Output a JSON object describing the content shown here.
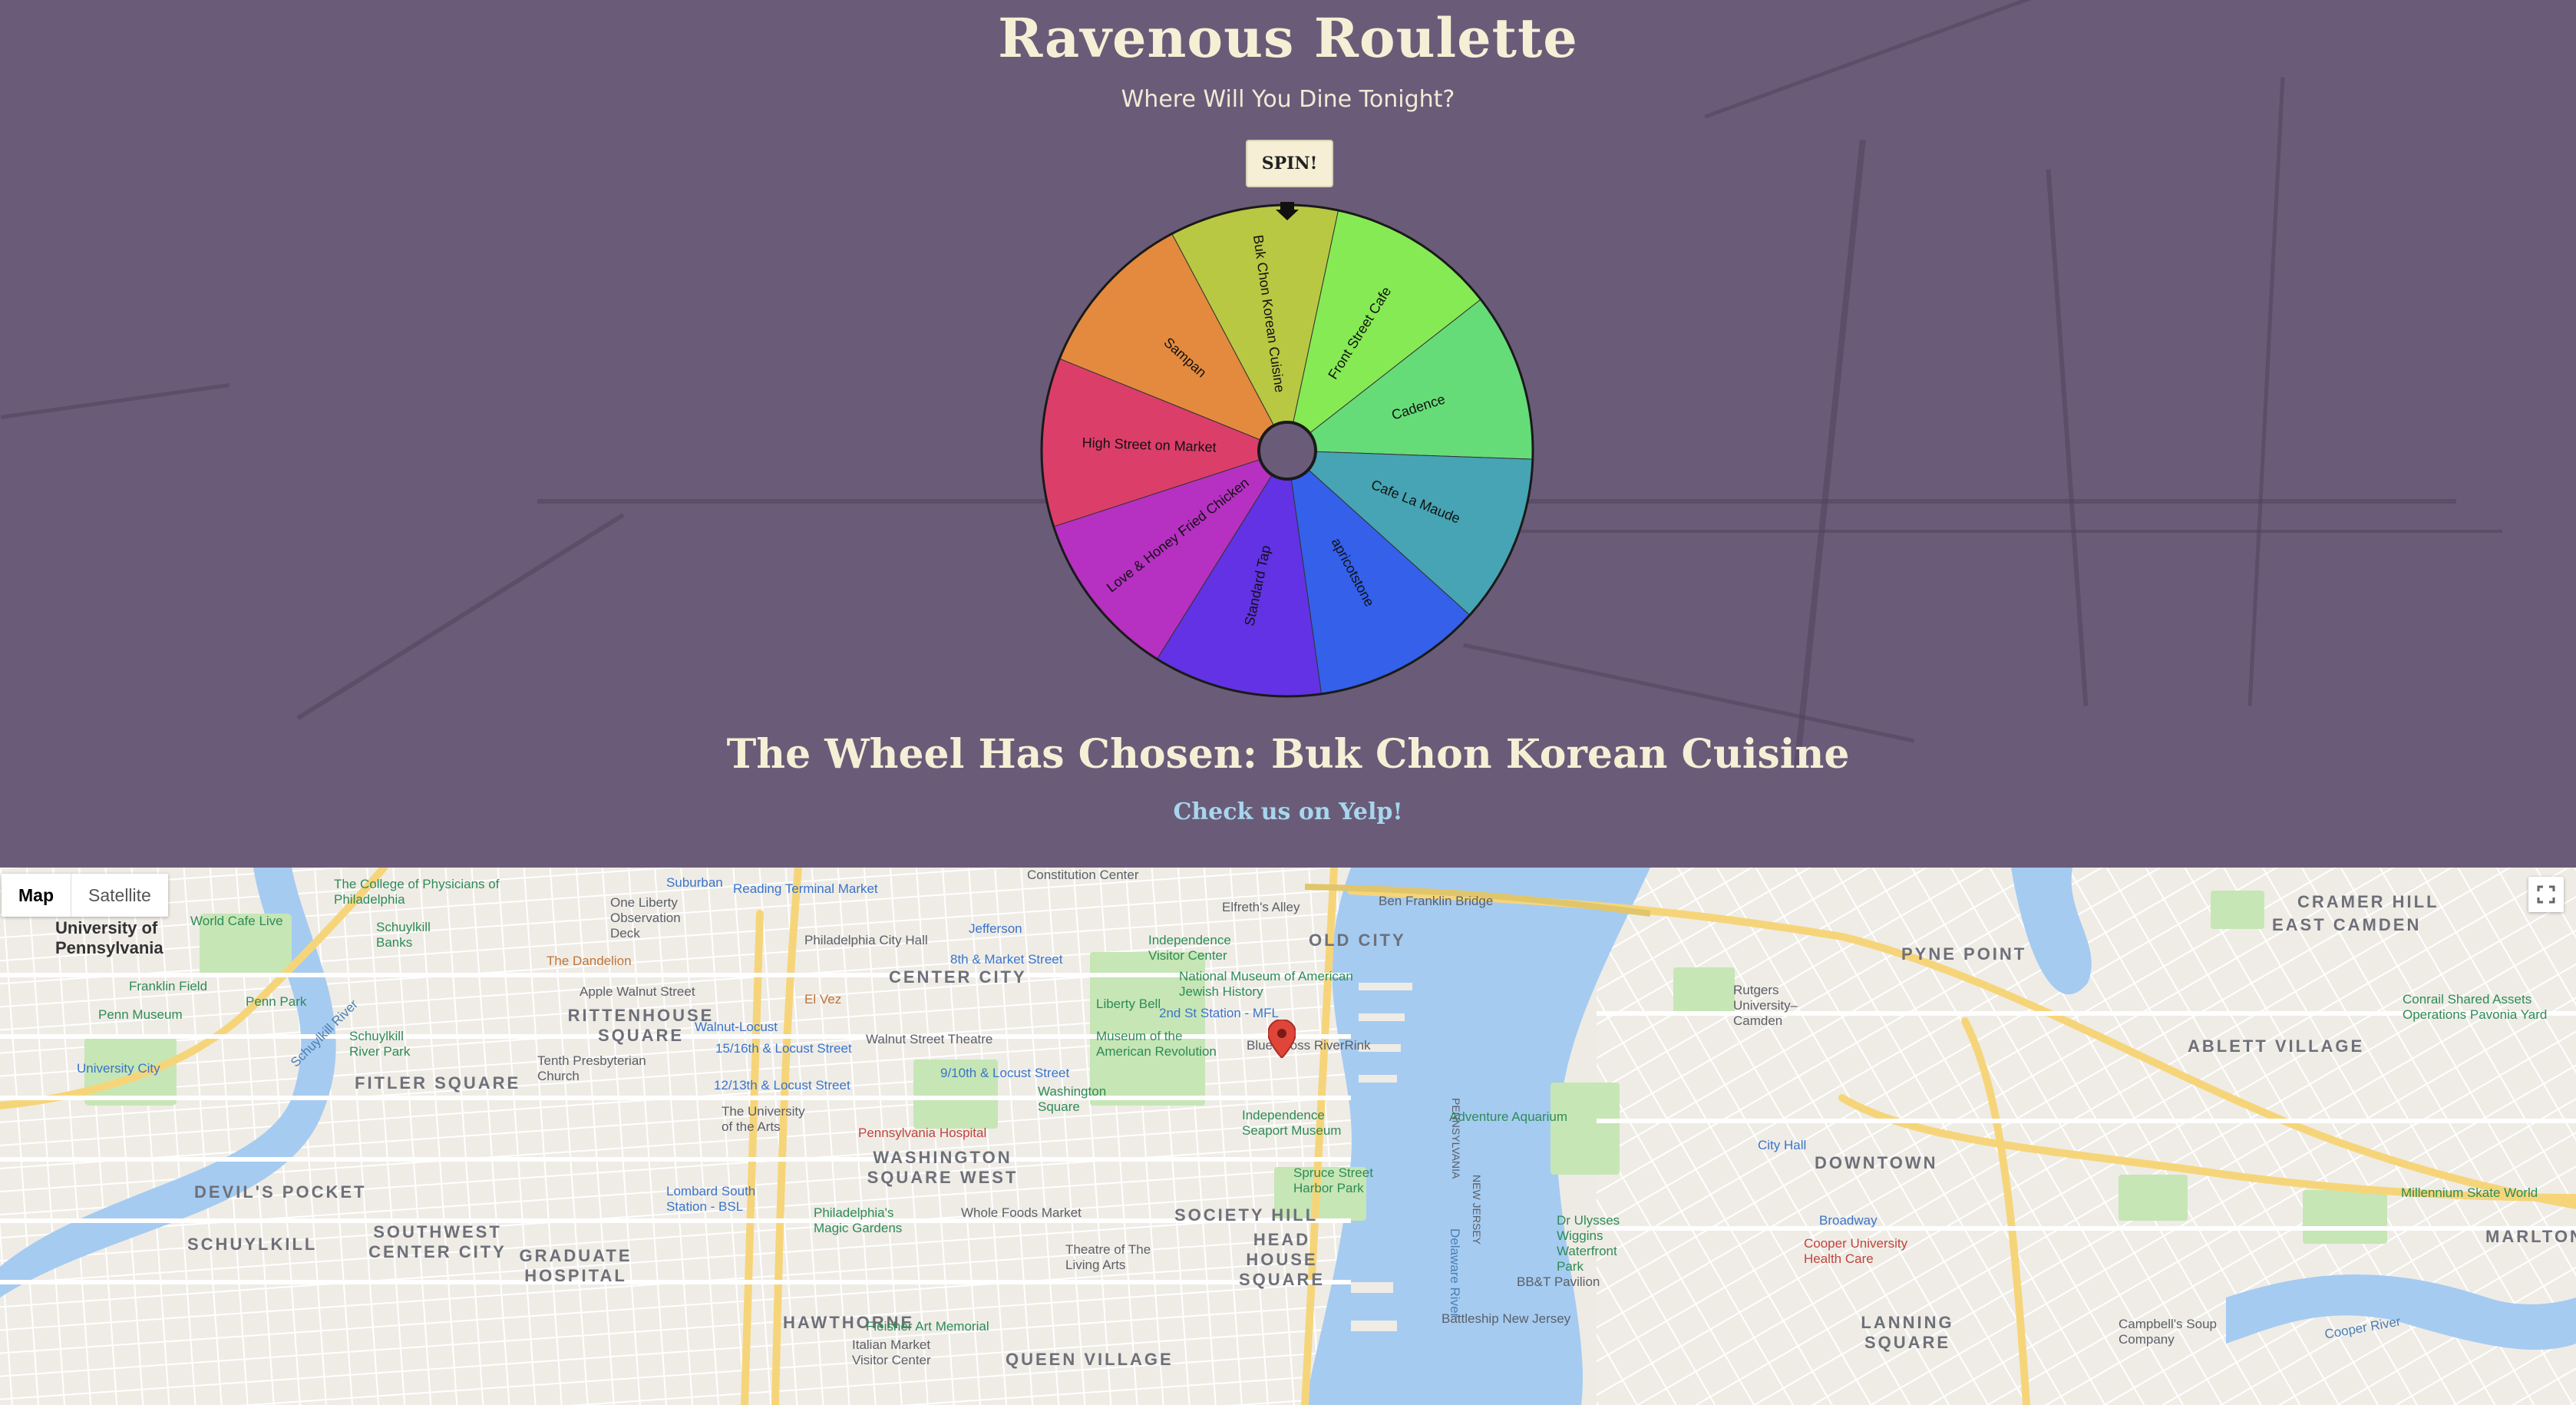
{
  "app": {
    "title": "Ravenous Roulette",
    "subtitle": "Where Will You Dine Tonight?",
    "spin_label": "SPIN!",
    "result_prefix": "The Wheel Has Chosen:",
    "result_name": "Buk Chon Korean Cuisine",
    "yelp_link": "Check us on Yelp!"
  },
  "wheel": {
    "slices": [
      {
        "label": "Buk Chon Korean Cuisine",
        "color": "#b8c842"
      },
      {
        "label": "Front Street Cafe",
        "color": "#86ea54"
      },
      {
        "label": "Cadence",
        "color": "#66dc78"
      },
      {
        "label": "Cafe La Maude",
        "color": "#46a4b4"
      },
      {
        "label": "apricotstone",
        "color": "#3460ea"
      },
      {
        "label": "Standard Tap",
        "color": "#6232e4"
      },
      {
        "label": "Love & Honey Fried Chicken",
        "color": "#b630c2"
      },
      {
        "label": "High Street on Market",
        "color": "#dc3e6a"
      },
      {
        "label": "Sampan",
        "color": "#e48a3e"
      }
    ]
  },
  "map": {
    "controls": {
      "map": "Map",
      "satellite": "Satellite"
    },
    "icons": {
      "fullscreen": "fullscreen-icon",
      "marker": "map-marker-icon"
    },
    "labels": {
      "city_center": "CENTER CITY",
      "old_city": "OLD CITY",
      "rittenhouse": "RITTENHOUSE SQUARE",
      "fitler": "FITLER SQUARE",
      "wsw": "WASHINGTON SQUARE WEST",
      "society_hill": "SOCIETY HILL",
      "head_house": "HEAD HOUSE SQUARE",
      "devils_pocket": "DEVIL'S POCKET",
      "schuylkill": "SCHUYLKILL",
      "sw_center": "SOUTHWEST CENTER CITY",
      "graduate": "GRADUATE HOSPITAL",
      "hawthorne": "HAWTHORNE",
      "queen_village": "QUEEN VILLAGE",
      "cramer": "CRAMER HILL",
      "east_camden": "EAST CAMDEN",
      "pyne": "PYNE POINT",
      "ablett": "ABLETT VILLAGE",
      "downtown": "DOWNTOWN",
      "marlton": "MARLTON",
      "lanning": "LANNING SQUARE",
      "upenn": "University of Pennsylvania",
      "reading": "Reading Terminal Market",
      "city_hall": "Philadelphia City Hall",
      "independence_visitor": "Independence Visitor Center",
      "liberty_bell": "Liberty Bell",
      "jewish_history": "National Museum of American Jewish History",
      "am_revolution": "Museum of the American Revolution",
      "rink": "Blue Cross RiverRink",
      "seaport": "Independence Seaport Museum",
      "harbor_park": "Spruce Street Harbor Park",
      "aquarium": "Adventure Aquarium",
      "wiggins": "Dr Ulysses Wiggins Waterfront Park",
      "bbt": "BB&T Pavilion",
      "battleship": "Battleship New Jersey",
      "rutgers": "Rutgers University–Camden",
      "cooper_hosp": "Cooper University Health Care",
      "campbell": "Campbell's Soup Company",
      "millennium": "Millennium Skate World",
      "conrail": "Conrail Shared Assets Operations Pavonia Yard",
      "ben_franklin": "Ben Franklin Bridge",
      "elfreth": "Elfreth's Alley",
      "jefferson": "Jefferson",
      "dandelion": "The Dandelion",
      "el_vez": "El Vez",
      "walnut_theatre": "Walnut Street Theatre",
      "penn_hospital": "Pennsylvania Hospital",
      "wholefoods": "Whole Foods Market",
      "magic_gardens": "Philadelphia's Magic Gardens",
      "living_arts": "Theatre of The Living Arts",
      "fleisher": "Fleisher Art Memorial",
      "italian_market": "Italian Market Visitor Center",
      "penn_park": "Penn Park",
      "franklin_field": "Franklin Field",
      "penn_museum": "Penn Museum",
      "world_cafe": "World Cafe Live",
      "schuylkill_banks": "Schuylkill Banks",
      "schuylkill_river_park": "Schuylkill River Park",
      "delaware_river": "Delaware River",
      "schuylkill_river": "Schuylkill River",
      "cooper_river": "Cooper River",
      "pennsylvania": "PENNSYLVANIA",
      "new_jersey": "NEW JERSEY",
      "one_liberty": "One Liberty Observation Deck",
      "college_phys": "The College of Physicians of Philadelphia",
      "apple": "Apple Walnut Street",
      "suburban": "Suburban",
      "constitution": "Constitution Center",
      "eighth_market": "8th & Market Street",
      "second_st": "2nd St Station - MFL",
      "walnut_locust": "Walnut-Locust",
      "fifteenth": "15/16th & Locust Street",
      "ninth": "9/10th & Locust Street",
      "twelfth": "12/13th & Locust Street",
      "washington_sq": "Washington Square",
      "u_arts": "The University of the Arts",
      "tenth_presby": "Tenth Presbyterian Church",
      "lombard": "Lombard South Station - BSL",
      "broadway": "Broadway",
      "city_hall_camden": "City Hall",
      "university_city": "University City"
    }
  }
}
